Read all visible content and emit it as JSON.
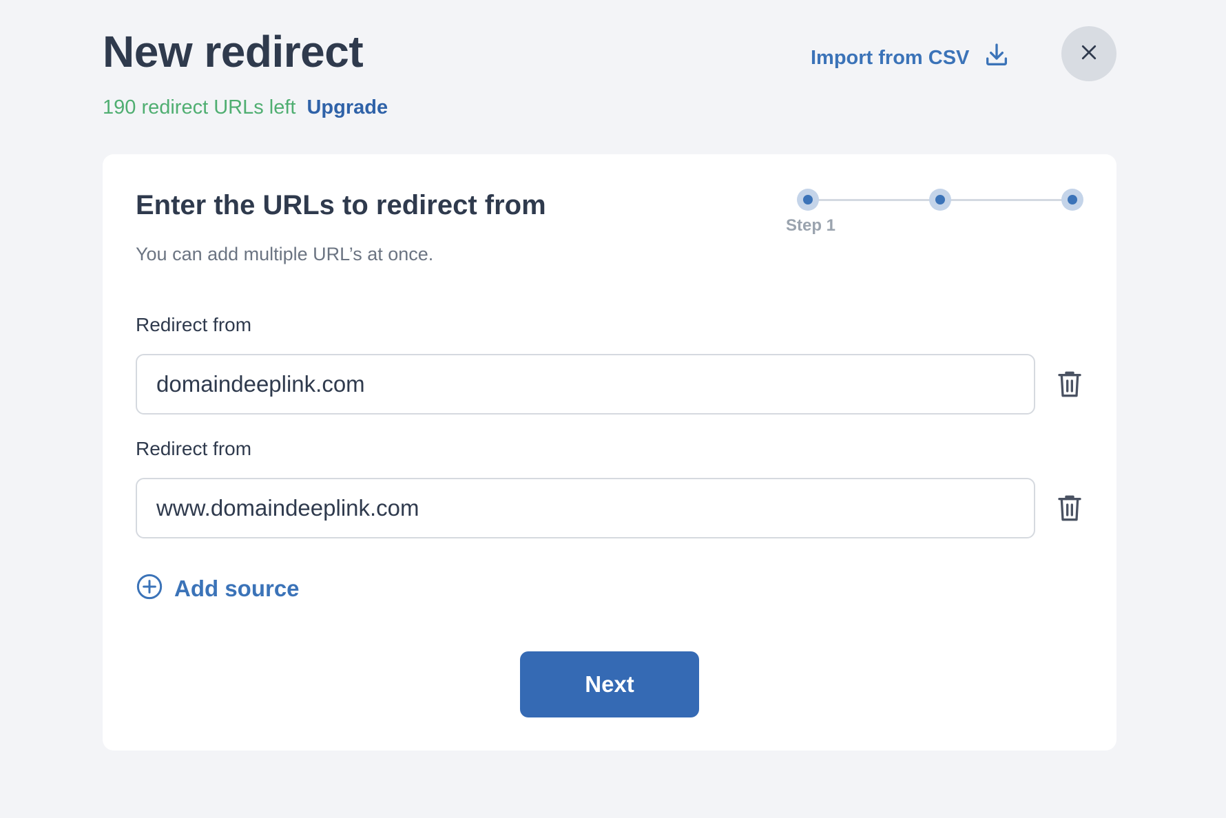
{
  "header": {
    "title": "New redirect",
    "urls_left": "190 redirect URLs left",
    "upgrade_label": "Upgrade",
    "import_label": "Import from CSV"
  },
  "card": {
    "heading": "Enter the URLs to redirect from",
    "subheading": "You can add multiple URL’s at once.",
    "stepper": {
      "steps": 3,
      "current_step_label": "Step 1"
    },
    "fields": [
      {
        "label": "Redirect from",
        "value": "domaindeeplink.com"
      },
      {
        "label": "Redirect from",
        "value": "www.domaindeeplink.com"
      }
    ],
    "add_source_label": "Add source",
    "next_label": "Next"
  },
  "colors": {
    "background": "#f3f4f7",
    "accent": "#3b73b8",
    "primary_button": "#356ab4",
    "success_text": "#4fae71",
    "heading_text": "#2f3a4d"
  },
  "icons": {
    "import": "download-icon",
    "close": "close-icon",
    "delete": "trash-icon",
    "add": "plus-circle-icon"
  }
}
